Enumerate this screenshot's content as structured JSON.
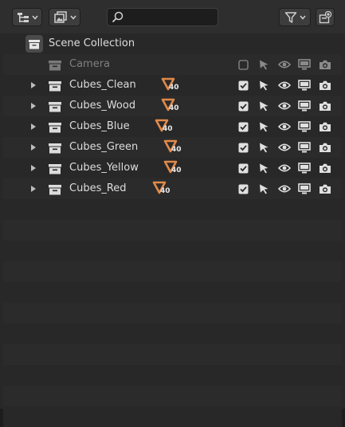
{
  "header": {
    "display_mode_icon": "outliner-hierarchy-icon",
    "filter_type_icon": "image-stack-icon",
    "search": {
      "value": "",
      "placeholder": ""
    },
    "filter_icon": "funnel-icon",
    "new_collection_icon": "new-collection-icon"
  },
  "outliner": {
    "scene_collection": {
      "label": "Scene Collection",
      "icon": "scene-collection-icon"
    },
    "items": [
      {
        "label": "Camera",
        "dimmed": true,
        "expandable": false,
        "mesh_count": "",
        "checked": false
      },
      {
        "label": "Cubes_Clean",
        "dimmed": false,
        "expandable": true,
        "mesh_count": "40",
        "checked": true
      },
      {
        "label": "Cubes_Wood",
        "dimmed": false,
        "expandable": true,
        "mesh_count": "40",
        "checked": true
      },
      {
        "label": "Cubes_Blue",
        "dimmed": false,
        "expandable": true,
        "mesh_count": "40",
        "checked": true
      },
      {
        "label": "Cubes_Green",
        "dimmed": false,
        "expandable": true,
        "mesh_count": "40",
        "checked": true
      },
      {
        "label": "Cubes_Yellow",
        "dimmed": false,
        "expandable": true,
        "mesh_count": "40",
        "checked": true
      },
      {
        "label": "Cubes_Red",
        "dimmed": false,
        "expandable": true,
        "mesh_count": "40",
        "checked": true
      }
    ]
  },
  "colors": {
    "background": "#282828",
    "row_alt": "#2b2b2b",
    "header": "#2e2e2e",
    "text": "#dddddd",
    "text_dim": "#7f7f7f",
    "mesh_orange": "#e08a4a"
  }
}
